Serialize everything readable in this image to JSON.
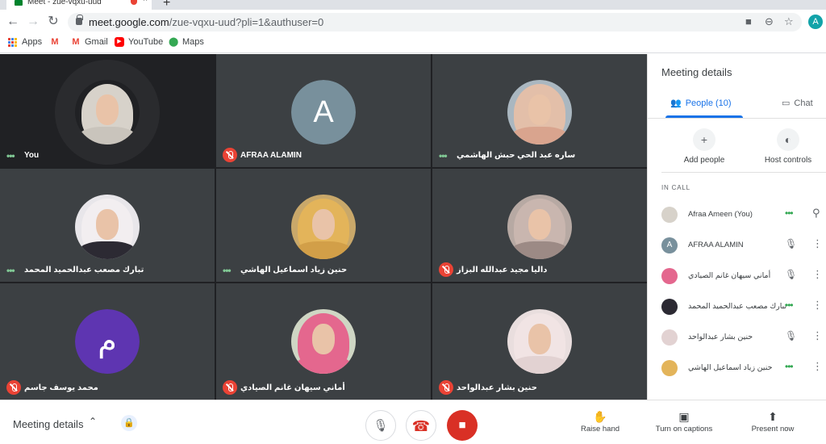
{
  "browser": {
    "tab_title": "Meet - zue-vqxu-uud",
    "new_tab": "+",
    "close_tab": "×",
    "back": "←",
    "forward": "→",
    "reload": "↻",
    "url_host": "meet.google.com",
    "url_rest": "/zue-vqxu-uud?pli=1&authuser=0",
    "profile_initial": "A",
    "bookmarks": [
      {
        "label": "Apps",
        "icon": "apps-grid-icon"
      },
      {
        "label": "",
        "icon": "gmail-icon"
      },
      {
        "label": "Gmail",
        "icon": "gmail-icon"
      },
      {
        "label": "YouTube",
        "icon": "youtube-icon"
      },
      {
        "label": "Maps",
        "icon": "maps-icon"
      }
    ]
  },
  "tiles": [
    {
      "name": "You",
      "status": "talking",
      "avatar": "photo"
    },
    {
      "name": "AFRAA ALAMIN",
      "status": "muted",
      "avatar": "letter",
      "letter": "A",
      "color": "#78909c"
    },
    {
      "name": "ساره عبد الحي حبش الهاشمي",
      "status": "talking",
      "avatar": "photo"
    },
    {
      "name": "تبارك مصعب عبدالحميد المحمد",
      "status": "talking",
      "avatar": "photo"
    },
    {
      "name": "حنين زياد اسماعيل الهاشي",
      "status": "talking",
      "avatar": "photo"
    },
    {
      "name": "داليا مجيد عبدالله البزاز",
      "status": "muted",
      "avatar": "photo"
    },
    {
      "name": "محمد يوسف جاسم",
      "status": "muted",
      "avatar": "letter",
      "letter": "م",
      "color": "#5e35b1"
    },
    {
      "name": "أماني سيهان غانم الصيادي",
      "status": "muted",
      "avatar": "photo"
    },
    {
      "name": "حنين بشار عبدالواحد",
      "status": "muted",
      "avatar": "photo"
    }
  ],
  "panel": {
    "title": "Meeting details",
    "tab_people": "People (10)",
    "tab_chat": "Chat",
    "add_people": "Add people",
    "host_controls": "Host controls",
    "in_call": "IN CALL",
    "people": [
      {
        "name": "Afraa Ameen (You)",
        "status": "talking",
        "avatar": "photo"
      },
      {
        "name": "AFRAA ALAMIN",
        "status": "muted",
        "avatar": "letter",
        "letter": "A"
      },
      {
        "name": "أماني سيهان غانم الصيادي",
        "status": "muted",
        "avatar": "photo"
      },
      {
        "name": "تبارك مصعب عبدالحميد المحمد",
        "status": "talking",
        "avatar": "photo"
      },
      {
        "name": "حنين بشار عبدالواحد",
        "status": "muted",
        "avatar": "photo"
      },
      {
        "name": "حنين زياد اسماعيل الهاشي",
        "status": "talking",
        "avatar": "photo"
      }
    ]
  },
  "bottom": {
    "meeting_details": "Meeting details",
    "raise_hand": "Raise hand",
    "captions": "Turn on captions",
    "present": "Present now"
  },
  "colors": {
    "accent": "#1a73e8",
    "danger": "#d93025",
    "stage_bg": "#202124",
    "tile_bg": "#3c4043"
  }
}
